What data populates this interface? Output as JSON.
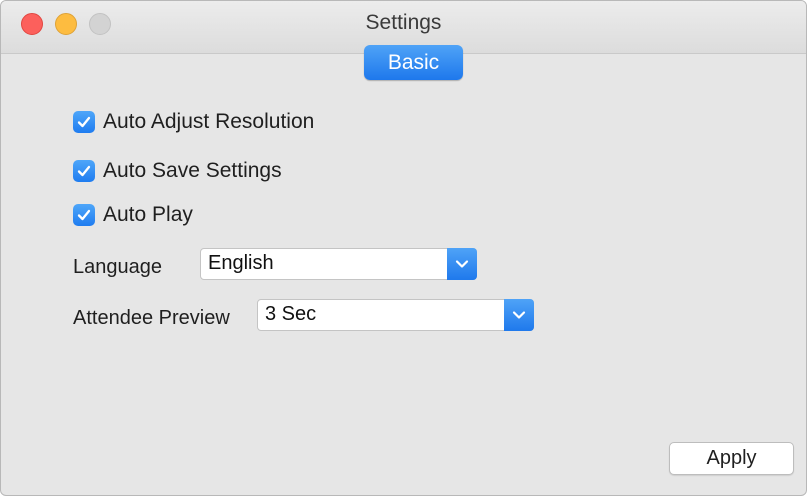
{
  "window": {
    "title": "Settings"
  },
  "tabs": [
    {
      "label": "Basic",
      "selected": true
    }
  ],
  "options": [
    {
      "label": "Auto Adjust Resolution",
      "checked": true
    },
    {
      "label": "Auto Save Settings",
      "checked": true
    },
    {
      "label": "Auto Play",
      "checked": true
    }
  ],
  "language": {
    "label": "Language",
    "value": "English"
  },
  "attendee_preview": {
    "label": "Attendee Preview",
    "value": "3 Sec"
  },
  "buttons": {
    "apply_label": "Apply"
  },
  "colors": {
    "accent": "#1f7cf0",
    "close": "#fc605c",
    "minimize": "#fdbc40",
    "zoom_disabled": "#d3d3d3"
  }
}
